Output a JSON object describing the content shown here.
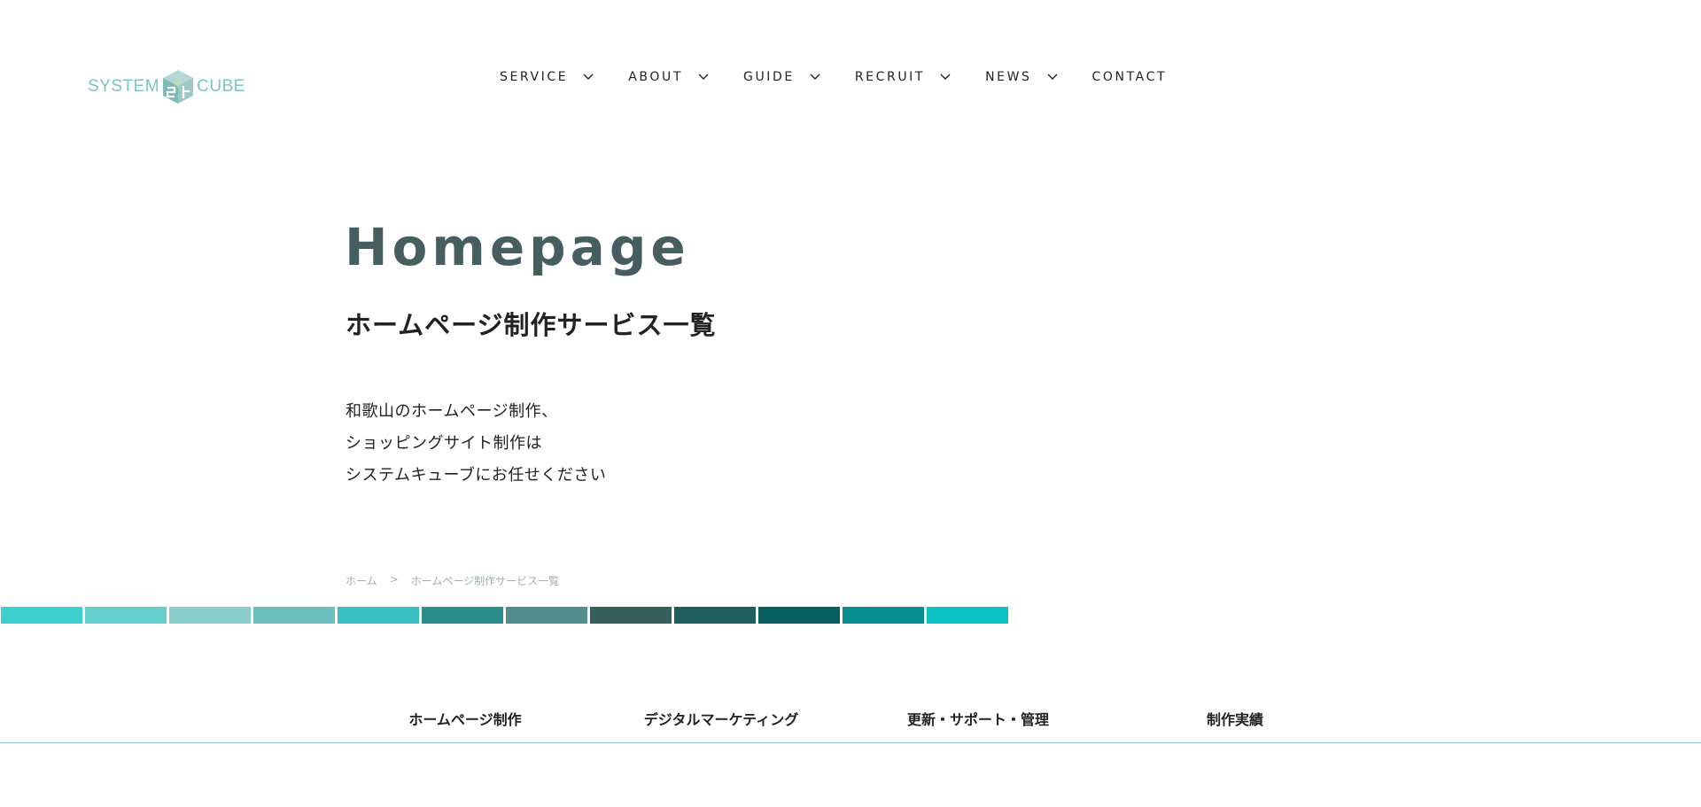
{
  "logo": {
    "left_text": "SYSTEM",
    "right_text": "CUBE",
    "icon": "cube-logo-icon",
    "text_color": "#7cc3c3"
  },
  "nav": {
    "items": [
      {
        "label": "SERVICE",
        "has_dropdown": true
      },
      {
        "label": "ABOUT",
        "has_dropdown": true
      },
      {
        "label": "GUIDE",
        "has_dropdown": true
      },
      {
        "label": "RECRUIT",
        "has_dropdown": true
      },
      {
        "label": "NEWS",
        "has_dropdown": true
      },
      {
        "label": "CONTACT",
        "has_dropdown": false
      }
    ]
  },
  "hero": {
    "title": "Homepage",
    "subtitle": "ホームページ制作サービス一覧",
    "description": [
      "和歌山のホームページ制作、",
      "ショッピングサイト制作は",
      "システムキューブにお任せください"
    ],
    "title_color": "#465e5f"
  },
  "breadcrumb": {
    "home": "ホーム",
    "separator": ">",
    "current": "ホームページ制作サービス一覧"
  },
  "color_bar": {
    "colors": [
      "#3ecfcf",
      "#63cfcd",
      "#8ccfcd",
      "#6bc0bf",
      "#3abfc0",
      "#2a8d8c",
      "#528f8d",
      "#365e5d",
      "#1e5f5e",
      "#065e5e",
      "#088e8e",
      "#0cc1c4"
    ]
  },
  "tabs": {
    "items": [
      {
        "label": "ホームページ制作"
      },
      {
        "label": "デジタルマーケティング"
      },
      {
        "label": "更新・サポート・管理"
      },
      {
        "label": "制作実績"
      }
    ],
    "border_color": "#8cc3c8"
  }
}
